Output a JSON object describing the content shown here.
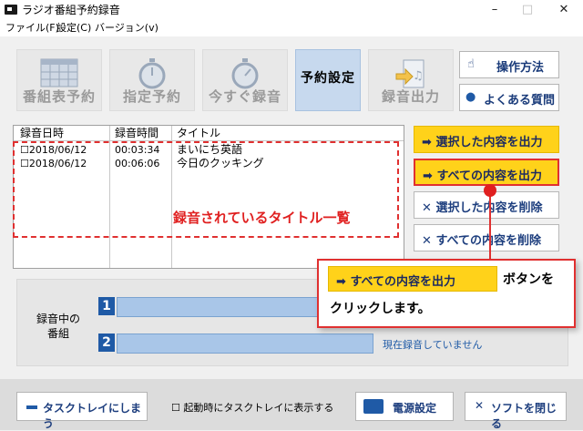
{
  "window": {
    "title": "ラジオ番組予約録音",
    "minimize": "–",
    "maximize": "□",
    "close": "✕"
  },
  "menu": [
    "ファイル(F)",
    "設定(C)",
    "バージョン(v)"
  ],
  "toolbar": {
    "program_guide": "番組表予約",
    "manual_reserve": "指定予約",
    "record_now": "今すぐ録音",
    "reserve_settings": "予約設定",
    "export": "録音出力",
    "how_to": "操作方法",
    "faq": "よくある質問"
  },
  "list": {
    "headers": [
      "録音日時",
      "録音時間",
      "タイトル"
    ],
    "rows": [
      {
        "date": "☐2018/06/12",
        "time": "00:03:34",
        "title": "まいにち英語"
      },
      {
        "date": "☐2018/06/12",
        "time": "00:06:06",
        "title": "今日のクッキング"
      }
    ],
    "annotation": "録音されているタイトル一覧"
  },
  "actions": {
    "export_selected": "選択した内容を出力",
    "export_all": "すべての内容を出力",
    "delete_selected": "選択した内容を削除",
    "delete_all": "すべての内容を削除"
  },
  "recording": {
    "label_line1": "録音中の",
    "label_line2": "番組",
    "slot1": "1",
    "slot2": "2",
    "status": "現在録音していません"
  },
  "bottom": {
    "minimize_tray": "タスクトレイにしまう",
    "startup_tray": "起動時にタスクトレイに表示する",
    "power_settings": "電源設定",
    "close_app": "ソフトを閉じる"
  },
  "callout": {
    "button": "すべての内容を出力",
    "text1": "ボタンを",
    "text2": "クリックします。"
  },
  "colors": {
    "accent_yellow": "#ffd21a",
    "annotation_red": "#e03030",
    "button_text": "#1d3e7e"
  }
}
